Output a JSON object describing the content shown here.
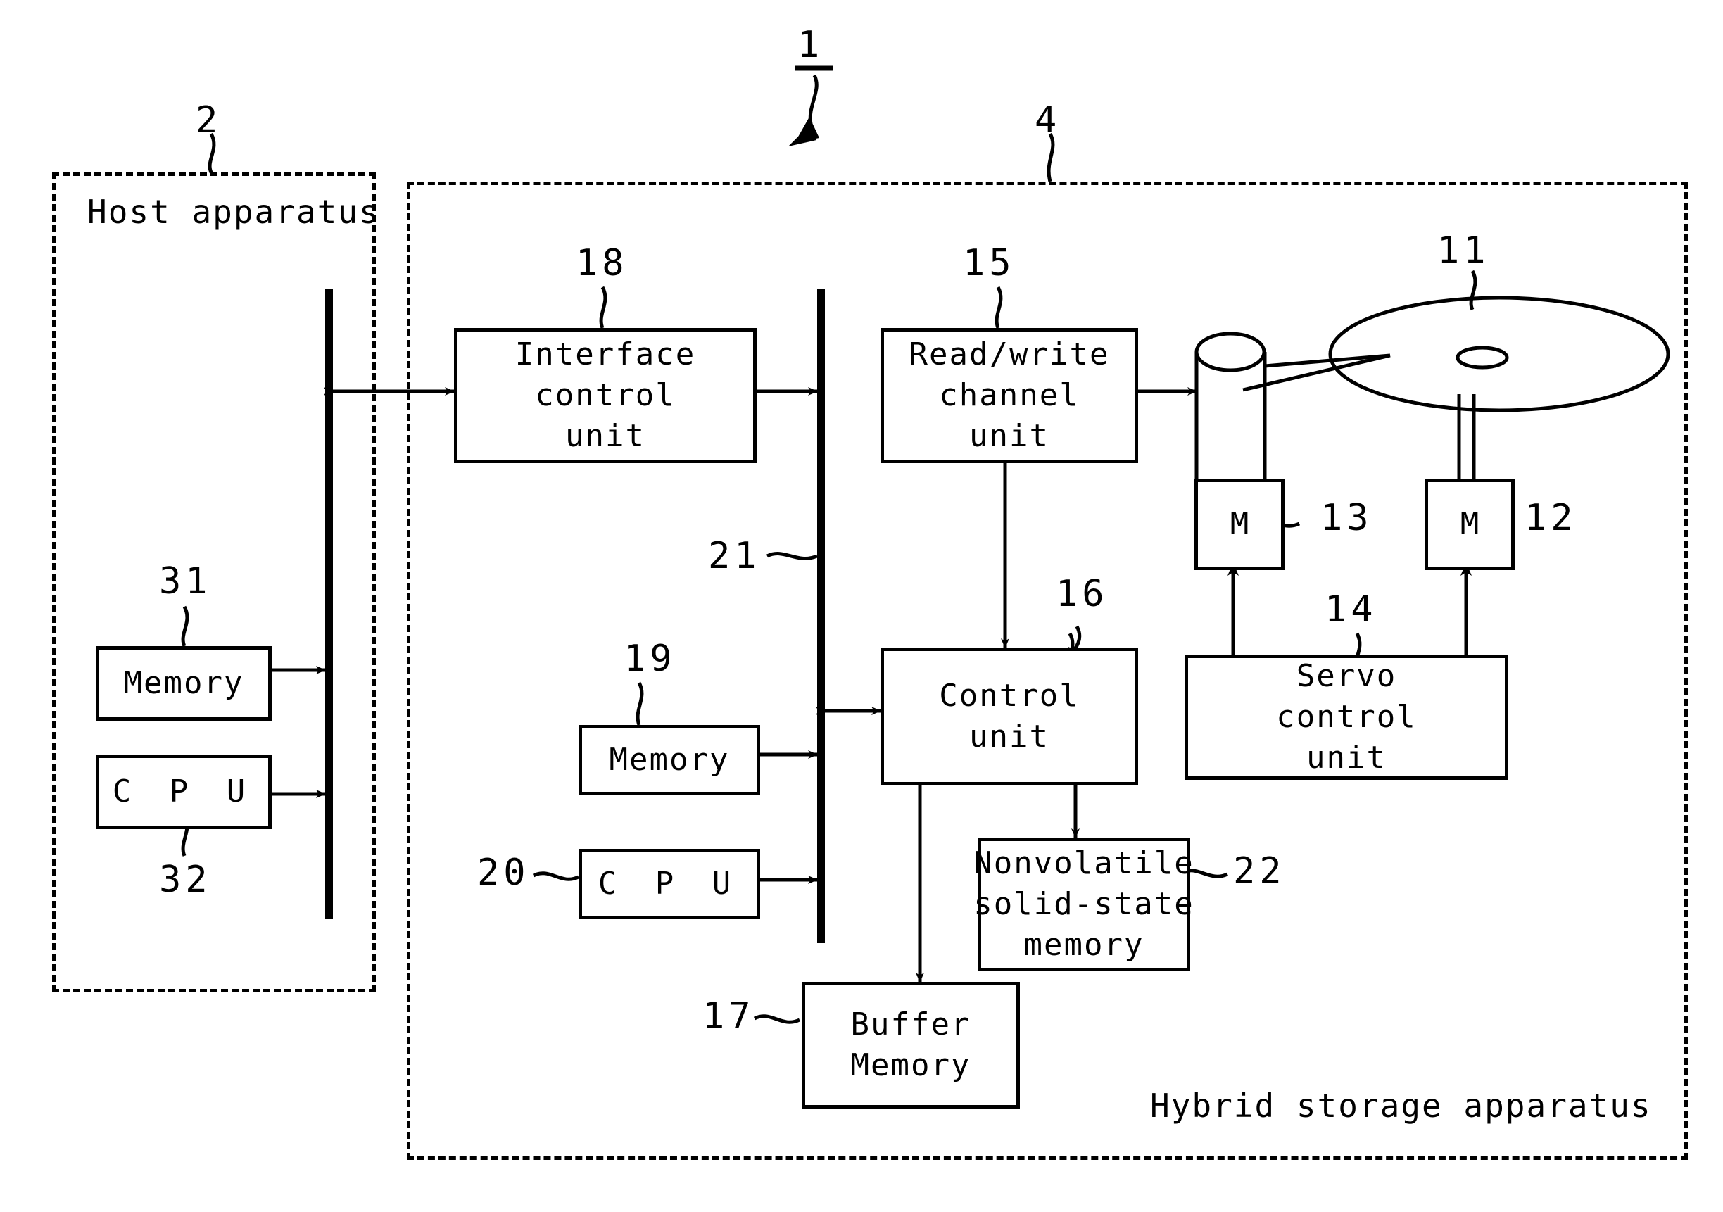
{
  "figure": {
    "type": "patent-block-diagram",
    "system_ref": "1",
    "host_enclosure": {
      "ref": "2",
      "caption": "Host apparatus"
    },
    "device_enclosure": {
      "ref": "4",
      "caption": "Hybrid storage apparatus"
    }
  },
  "host": {
    "caption": "Host apparatus",
    "ref": "2",
    "blocks": [
      {
        "ref": "31",
        "label": "Memory"
      },
      {
        "ref": "32",
        "label": "C P U"
      }
    ],
    "bus_name": "host-bus"
  },
  "device": {
    "caption": "Hybrid storage apparatus",
    "ref": "4",
    "bus_ref": "21",
    "blocks": [
      {
        "ref": "18",
        "lines": [
          "Interface",
          "control",
          "unit"
        ]
      },
      {
        "ref": "15",
        "lines": [
          "Read/write",
          "channel",
          "unit"
        ]
      },
      {
        "ref": "19",
        "lines": [
          "Memory"
        ]
      },
      {
        "ref": "20",
        "lines": [
          "C P U"
        ]
      },
      {
        "ref": "16",
        "lines": [
          "Control",
          "unit"
        ]
      },
      {
        "ref": "22",
        "lines": [
          "Nonvolatile",
          "solid-state",
          "memory"
        ]
      },
      {
        "ref": "17",
        "lines": [
          "Buffer",
          "Memory"
        ]
      },
      {
        "ref": "14",
        "lines": [
          "Servo",
          "control",
          "unit"
        ]
      },
      {
        "ref": "13",
        "lines": [
          "M"
        ]
      },
      {
        "ref": "12",
        "lines": [
          "M"
        ]
      }
    ],
    "mechanics": [
      {
        "ref": "11",
        "name": "magnetic-disk"
      },
      {
        "ref": "13",
        "name": "voice-coil-motor"
      },
      {
        "ref": "12",
        "name": "spindle-motor"
      }
    ]
  },
  "refs": {
    "r1": "1",
    "r2": "2",
    "r4": "4",
    "r11": "11",
    "r12": "12",
    "r13": "13",
    "r14": "14",
    "r15": "15",
    "r16": "16",
    "r17": "17",
    "r18": "18",
    "r19": "19",
    "r20": "20",
    "r21": "21",
    "r22": "22",
    "r31": "31",
    "r32": "32"
  },
  "labels": {
    "host_caption": "Host apparatus",
    "device_caption": "Hybrid storage apparatus",
    "memory": "Memory",
    "cpu": "C P U",
    "interface_l1": "Interface",
    "interface_l2": "control",
    "interface_l3": "unit",
    "rw_l1": "Read/write",
    "rw_l2": "channel",
    "rw_l3": "unit",
    "control_l1": "Control",
    "control_l2": "unit",
    "nvm_l1": "Nonvolatile",
    "nvm_l2": "solid-state",
    "nvm_l3": "memory",
    "buffer_l1": "Buffer",
    "buffer_l2": "Memory",
    "servo_l1": "Servo",
    "servo_l2": "control",
    "servo_l3": "unit",
    "motor": "M"
  }
}
